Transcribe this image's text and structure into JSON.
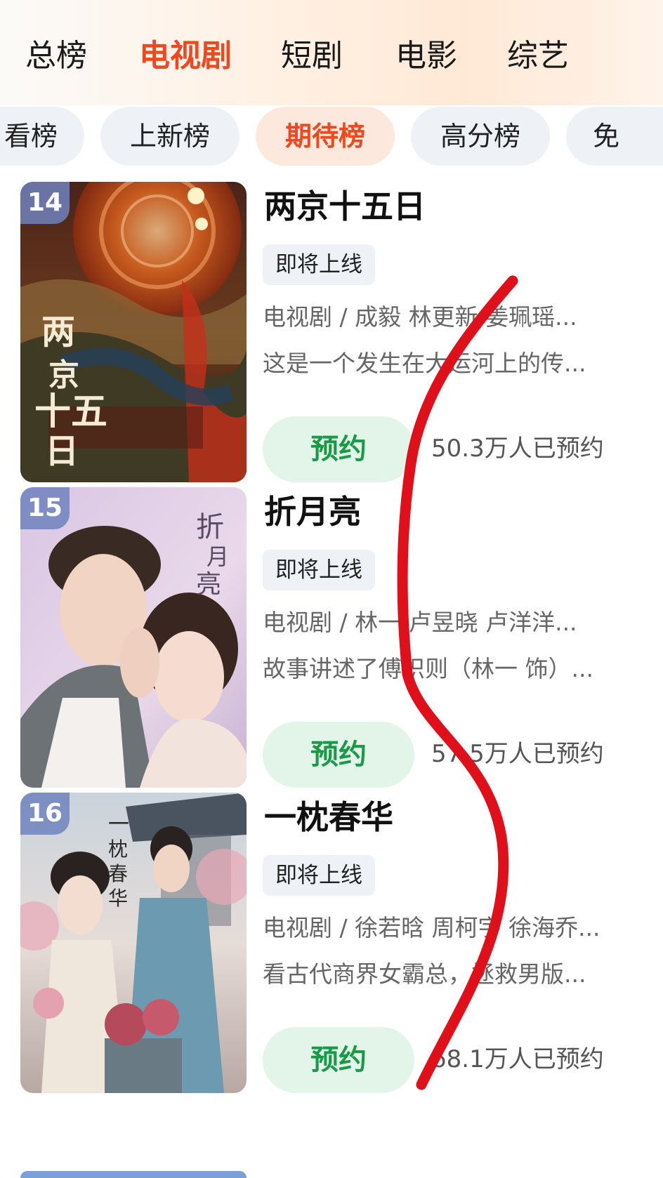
{
  "top_tabs": [
    "总榜",
    "电视剧",
    "短剧",
    "电影",
    "综艺"
  ],
  "active_tab": "电视剧",
  "sub_tabs": [
    "看榜",
    "上新榜",
    "期待榜",
    "高分榜",
    "免"
  ],
  "active_sub_tab": "期待榜",
  "items": [
    {
      "rank": "14",
      "title": "两京十五日",
      "status": "即将上线",
      "meta": "电视剧 / 成毅 林更新 姜珮瑶...",
      "desc": "这是一个发生在大运河上的传...",
      "button": "预约",
      "count": "50.3万人已预约"
    },
    {
      "rank": "15",
      "title": "折月亮",
      "status": "即将上线",
      "meta": "电视剧 / 林一 卢昱晓 卢洋洋...",
      "desc": "故事讲述了傅织则（林一 饰）...",
      "button": "预约",
      "count": "57.5万人已预约"
    },
    {
      "rank": "16",
      "title": "一枕春华",
      "status": "即将上线",
      "meta": "电视剧 / 徐若晗 周柯宇 徐海乔...",
      "desc": "看古代商界女霸总，拯救男版...",
      "button": "预约",
      "count": "68.1万人已预约"
    }
  ],
  "colors": {
    "accent": "#f0481e",
    "reserve_green": "#1a9a48",
    "annotation_red": "#e0101a"
  }
}
